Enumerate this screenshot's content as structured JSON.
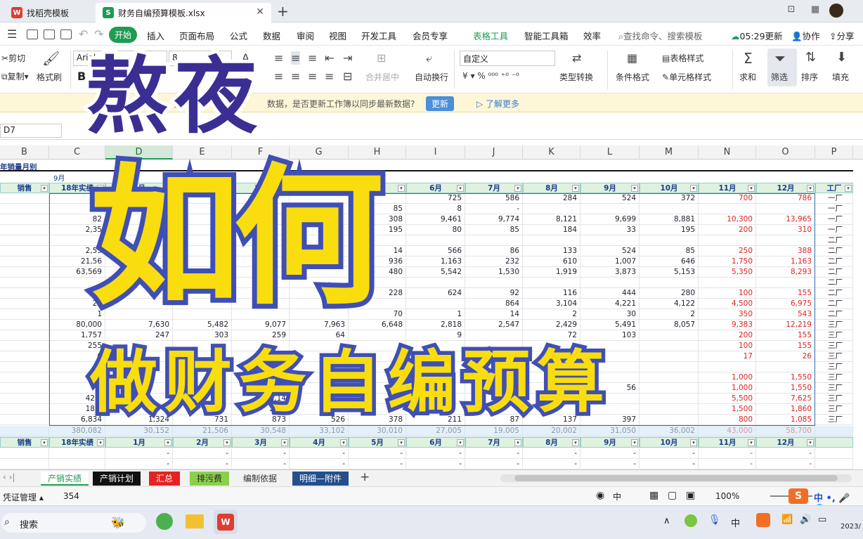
{
  "tabs": [
    {
      "label": "找稻壳模板",
      "icon_color": "#e03c31",
      "icon_text": "W"
    },
    {
      "label": "财务自编预算模板.xlsx",
      "icon_color": "#1f9b54",
      "icon_text": "S"
    }
  ],
  "menu": [
    "开始",
    "插入",
    "页面布局",
    "公式",
    "数据",
    "审阅",
    "视图",
    "开发工具",
    "会员专享",
    "表格工具",
    "智能工具箱",
    "效率"
  ],
  "search_placeholder": "查找命令、搜索模板",
  "topright": {
    "time": "05:29更新",
    "collab": "协作",
    "share": "分享"
  },
  "ribbon": {
    "cut": "剪切",
    "copy": "复制",
    "format_painter": "格式刷",
    "font_name": "Arial",
    "font_size": "8",
    "merge": "合并居中",
    "wrap": "自动换行",
    "number_format": "自定义",
    "convert": "类型转换",
    "cond_format": "条件格式",
    "table_style": "表格样式",
    "cell_style": "单元格样式",
    "sum": "求和",
    "filter": "筛选",
    "sort": "排序",
    "fill": "填充",
    "bold": "B"
  },
  "notice": {
    "prefix": "此",
    "text": "数据，是否更新工作簿以同步最新数据?",
    "button": "更新",
    "more": "了解更多"
  },
  "name_box": "D7",
  "columns": [
    "B",
    "C",
    "D",
    "E",
    "F",
    "G",
    "H",
    "I",
    "J",
    "K",
    "L",
    "M",
    "N",
    "O",
    "P"
  ],
  "sheet_title": "年销量月别",
  "subtitle": "9月",
  "header_row": [
    "销售",
    "18年实绩",
    "1月",
    "2月",
    "3月",
    "4月",
    "5月",
    "6月",
    "7月",
    "8月",
    "9月",
    "10月",
    "11月",
    "12月",
    "工厂"
  ],
  "rows": [
    [
      "",
      "7",
      "",
      "",
      "",
      "",
      "",
      "725",
      "586",
      "284",
      "524",
      "372",
      "700",
      "786",
      "一厂"
    ],
    [
      "",
      "7",
      "",
      "",
      "",
      "",
      "85",
      "8",
      "-",
      "",
      "",
      "",
      "",
      "",
      "一厂"
    ],
    [
      "",
      "82",
      "",
      "",
      "",
      "",
      "308",
      "9,461",
      "9,774",
      "8,121",
      "9,699",
      "8,881",
      "10,300",
      "13,965",
      "一厂"
    ],
    [
      "",
      "2,35",
      "",
      "",
      "",
      "",
      "195",
      "80",
      "85",
      "184",
      "33",
      "195",
      "200",
      "310",
      "一厂"
    ],
    [
      "",
      "",
      "",
      "",
      "",
      "",
      "",
      "",
      "",
      "",
      "",
      "",
      "",
      "",
      "二厂"
    ],
    [
      "",
      "2,55",
      "",
      "",
      "",
      "",
      "14",
      "566",
      "86",
      "133",
      "524",
      "85",
      "250",
      "388",
      "二厂"
    ],
    [
      "",
      "21,56",
      "",
      "",
      "",
      "",
      "936",
      "1,163",
      "232",
      "610",
      "1,007",
      "646",
      "1,750",
      "1,163",
      "二厂"
    ],
    [
      "",
      "63,569",
      "",
      "",
      "",
      "",
      "480",
      "5,542",
      "1,530",
      "1,919",
      "3,873",
      "5,153",
      "5,350",
      "8,293",
      "二厂"
    ],
    [
      "",
      "",
      "",
      "",
      "",
      "",
      "",
      "",
      "",
      "",
      "",
      "",
      "",
      "",
      "二厂"
    ],
    [
      "",
      "4",
      "",
      "",
      "",
      "",
      "228",
      "624",
      "92",
      "116",
      "444",
      "280",
      "100",
      "155",
      "二厂"
    ],
    [
      "",
      "23",
      "",
      "",
      "",
      "",
      "",
      "",
      "864",
      "3,104",
      "4,221",
      "4,122",
      "4,500",
      "6,975",
      "二厂"
    ],
    [
      "",
      "1",
      "",
      "",
      "",
      "",
      "70",
      "1",
      "14",
      "2",
      "30",
      "2",
      "350",
      "543",
      "二厂"
    ],
    [
      "",
      "80,000",
      "7,630",
      "5,482",
      "9,077",
      "7,963",
      "6,648",
      "2,818",
      "2,547",
      "2,429",
      "5,491",
      "8,057",
      "9,383",
      "12,219",
      "三厂"
    ],
    [
      "",
      "1,757",
      "247",
      "303",
      "259",
      "64",
      "",
      "9",
      "",
      "72",
      "103",
      "",
      "200",
      "155",
      "三厂"
    ],
    [
      "",
      "255",
      "",
      "",
      "",
      "",
      "",
      "",
      "",
      "",
      "",
      "",
      "100",
      "155",
      "三厂"
    ],
    [
      "",
      "6",
      "",
      "",
      "",
      "",
      "",
      "",
      "",
      "",
      "",
      "",
      "17",
      "26",
      "三厂"
    ],
    [
      "",
      "",
      "",
      "",
      "",
      "",
      "",
      "",
      "",
      "",
      "",
      "",
      "",
      "",
      "三厂"
    ],
    [
      "",
      "",
      "",
      "",
      "",
      "",
      "",
      "",
      "",
      "",
      "",
      "",
      "1,000",
      "1,550",
      "三厂"
    ],
    [
      "",
      "",
      "",
      "",
      "",
      "",
      "",
      "",
      "",
      "",
      "56",
      "",
      "1,000",
      "1,550",
      "三厂"
    ],
    [
      "",
      "42,6",
      "",
      "",
      "3,14",
      "",
      "",
      "",
      "",
      "",
      "",
      "",
      "5,500",
      "7,625",
      "三厂"
    ],
    [
      "",
      "18,8",
      "",
      "",
      "2,19",
      "",
      "",
      "",
      "",
      "",
      "",
      "",
      "1,500",
      "1,860",
      "三厂"
    ],
    [
      "",
      "6,834",
      "1,324",
      "731",
      "873",
      "526",
      "378",
      "211",
      "87",
      "137",
      "397",
      "",
      "800",
      "1,085",
      "三厂"
    ]
  ],
  "total_row": [
    "",
    "380,082",
    "30,152",
    "21,506",
    "30,548",
    "33,102",
    "30,010",
    "27,005",
    "19,005",
    "20,002",
    "31,050",
    "36,002",
    "43,000",
    "58,700",
    ""
  ],
  "header_row2": [
    "销售",
    "18年实绩",
    "1月",
    "2月",
    "3月",
    "4月",
    "5月",
    "6月",
    "7月",
    "8月",
    "9月",
    "10月",
    "11月",
    "12月",
    ""
  ],
  "dash_rows": [
    [
      "",
      "",
      "-",
      "-",
      "-",
      "-",
      "-",
      "-",
      "-",
      "-",
      "-",
      "-",
      "-",
      "-",
      ""
    ],
    [
      "",
      "",
      "-",
      "-",
      "-",
      "-",
      "-",
      "-",
      "-",
      "-",
      "-",
      "-",
      "-",
      "-",
      ""
    ]
  ],
  "sheets": [
    {
      "label": "产销实绩",
      "bg": "#ffffff",
      "fg": "#1f9b54"
    },
    {
      "label": "产销计划",
      "bg": "#111111",
      "fg": "#ffffff"
    },
    {
      "label": "汇总",
      "bg": "#e52222",
      "fg": "#ffffff"
    },
    {
      "label": "排污费",
      "bg": "#8ccf4a",
      "fg": "#222222"
    },
    {
      "label": "编制依据",
      "bg": "#f2f2f2",
      "fg": "#333333"
    },
    {
      "label": "明细—附件",
      "bg": "#234f8c",
      "fg": "#ffffff"
    }
  ],
  "status": {
    "left": "凭证管理",
    "count": "354",
    "zoom": "100%",
    "ime": "中"
  },
  "taskbar": {
    "search": "搜索",
    "ime": "中",
    "date": "2023/"
  },
  "overlay": {
    "line1": "熬夜",
    "line2": "如何",
    "line3": "做财务自编预算"
  },
  "colors": {
    "accent": "#1f9b54",
    "header_bg": "#dff1df",
    "negative": "#dd2222"
  }
}
